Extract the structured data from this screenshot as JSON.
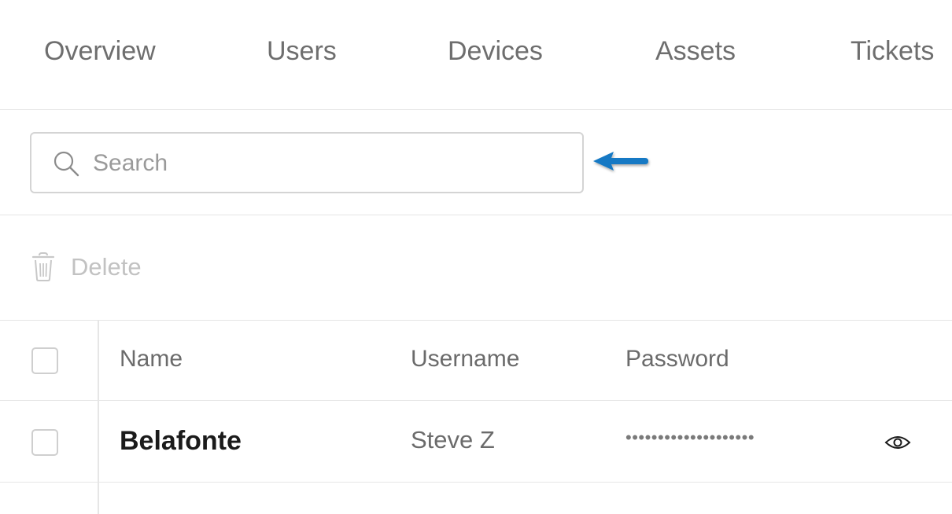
{
  "tabs": [
    {
      "label": "Overview"
    },
    {
      "label": "Users"
    },
    {
      "label": "Devices"
    },
    {
      "label": "Assets"
    },
    {
      "label": "Tickets"
    }
  ],
  "search": {
    "placeholder": "Search",
    "value": "",
    "icon": "search-icon"
  },
  "annotation": {
    "icon": "arrow-left-icon",
    "color": "#1479c4"
  },
  "toolbar": {
    "delete_label": "Delete",
    "delete_icon": "trash-icon"
  },
  "table": {
    "columns": [
      "Name",
      "Username",
      "Password"
    ],
    "rows": [
      {
        "name": "Belafonte",
        "username": "Steve Z",
        "password": "••••••••••••••••••••",
        "reveal_icon": "eye-icon"
      }
    ]
  }
}
